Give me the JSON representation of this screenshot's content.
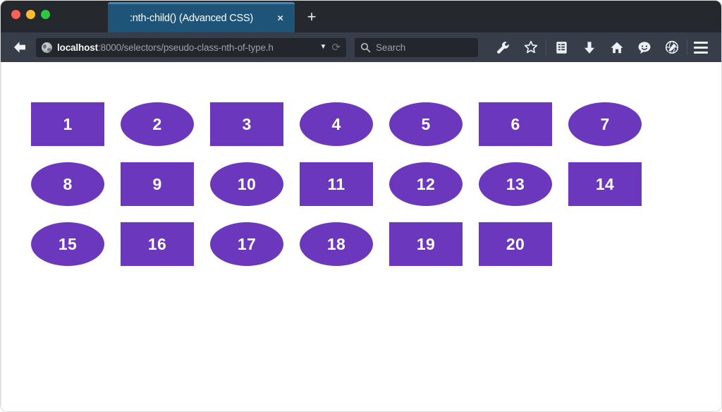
{
  "window": {
    "traffic_lights": [
      {
        "name": "close",
        "color": "#f9605a"
      },
      {
        "name": "minimize",
        "color": "#fcbc2d"
      },
      {
        "name": "maximize",
        "color": "#2bc840"
      }
    ]
  },
  "tab": {
    "title": ":nth-child() (Advanced CSS)",
    "close_label": "×",
    "new_tab_label": "+"
  },
  "toolbar": {
    "back_icon": "back-arrow-icon",
    "url": {
      "host": "localhost",
      "path": ":8000/selectors/pseudo-class-nth-of-type.h",
      "dropdown_caret": "▼",
      "reload_label": "⟳",
      "favicon": "globe-icon"
    },
    "search": {
      "placeholder": "Search",
      "icon": "magnifier-icon"
    },
    "icons": [
      {
        "name": "wrench-icon",
        "label": "Developer Tools"
      },
      {
        "name": "star-icon",
        "label": "Bookmark"
      },
      {
        "name": "reading-list-icon",
        "label": "Reading List"
      },
      {
        "name": "download-icon",
        "label": "Downloads"
      },
      {
        "name": "home-icon",
        "label": "Home"
      },
      {
        "name": "smiley-icon",
        "label": "Feedback"
      },
      {
        "name": "globe-pencil-icon",
        "label": "Annotate"
      }
    ],
    "menu_icon": "hamburger-menu-icon"
  },
  "page": {
    "background": "#ffffff",
    "shape_color": "#6a37bd",
    "shape_text_color": "#ffffff",
    "shapes": [
      {
        "n": 1,
        "label": "1",
        "shape": "rect"
      },
      {
        "n": 2,
        "label": "2",
        "shape": "pill"
      },
      {
        "n": 3,
        "label": "3",
        "shape": "rect"
      },
      {
        "n": 4,
        "label": "4",
        "shape": "pill"
      },
      {
        "n": 5,
        "label": "5",
        "shape": "pill"
      },
      {
        "n": 6,
        "label": "6",
        "shape": "rect"
      },
      {
        "n": 7,
        "label": "7",
        "shape": "pill"
      },
      {
        "n": 8,
        "label": "8",
        "shape": "pill"
      },
      {
        "n": 9,
        "label": "9",
        "shape": "rect"
      },
      {
        "n": 10,
        "label": "10",
        "shape": "pill"
      },
      {
        "n": 11,
        "label": "11",
        "shape": "rect"
      },
      {
        "n": 12,
        "label": "12",
        "shape": "pill"
      },
      {
        "n": 13,
        "label": "13",
        "shape": "pill"
      },
      {
        "n": 14,
        "label": "14",
        "shape": "rect"
      },
      {
        "n": 15,
        "label": "15",
        "shape": "pill"
      },
      {
        "n": 16,
        "label": "16",
        "shape": "rect"
      },
      {
        "n": 17,
        "label": "17",
        "shape": "pill"
      },
      {
        "n": 18,
        "label": "18",
        "shape": "pill"
      },
      {
        "n": 19,
        "label": "19",
        "shape": "rect"
      },
      {
        "n": 20,
        "label": "20",
        "shape": "rect"
      }
    ]
  }
}
